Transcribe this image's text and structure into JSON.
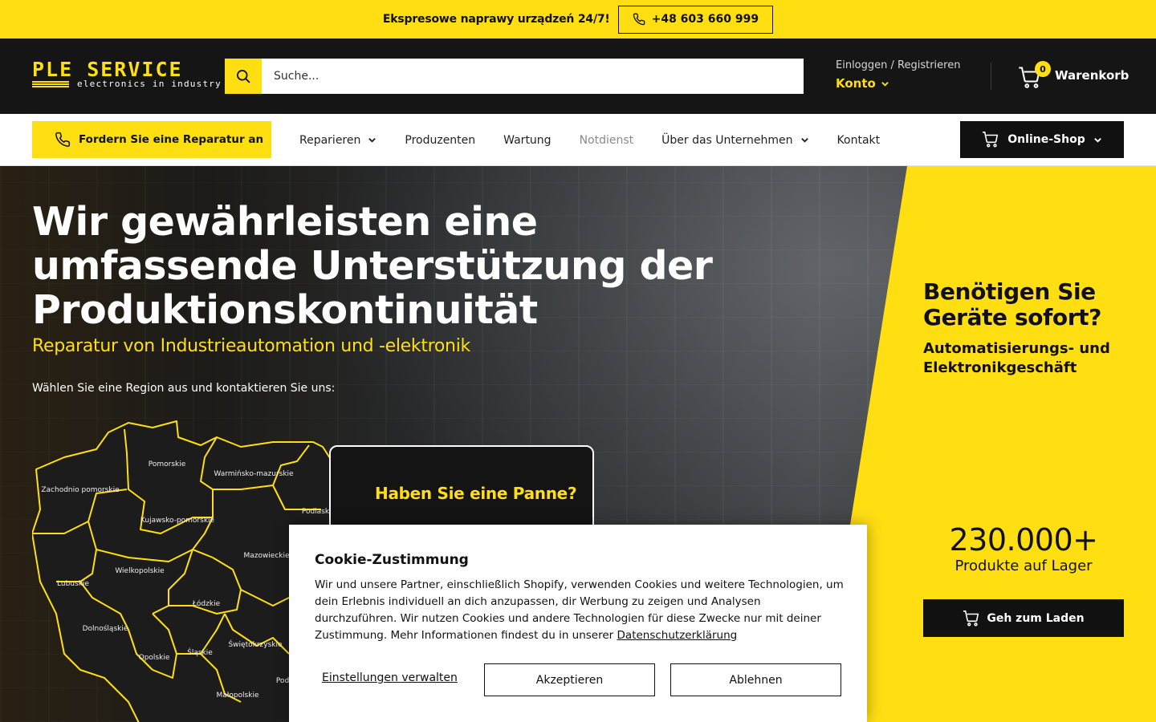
{
  "topbar": {
    "announcement": "Ekspresowe naprawy urządzeń 24/7!",
    "phone": "+48 603 660 999"
  },
  "header": {
    "logo_text": "PLE SERVICE",
    "logo_tagline": "electronics in industry",
    "search_placeholder": "Suche...",
    "login_label": "Einloggen / Registrieren",
    "account_label": "Konto",
    "cart_count": "0",
    "cart_label": "Warenkorb"
  },
  "nav": {
    "repair_button": "Fordern Sie eine Reparatur an",
    "links": [
      {
        "label": "Reparieren",
        "has_dropdown": true
      },
      {
        "label": "Produzenten",
        "has_dropdown": false
      },
      {
        "label": "Wartung",
        "has_dropdown": false
      },
      {
        "label": "Notdienst",
        "has_dropdown": false
      },
      {
        "label": "Über das Unternehmen",
        "has_dropdown": true
      },
      {
        "label": "Kontakt",
        "has_dropdown": false
      }
    ],
    "shop_button": "Online-Shop"
  },
  "hero": {
    "title": "Wir gewährleisten eine umfassende Unterstützung der Produktionskontinuität",
    "subtitle": "Reparatur von Industrieautomation und -elektronik",
    "region_prompt": "Wählen Sie eine Region aus und kontaktieren Sie uns:",
    "breakdown_title": "Haben Sie eine Panne?",
    "regions": [
      "Pomorskie",
      "Warmińsko-mazurskie",
      "Zachodnio pomorskie",
      "Kujawsko-pomorskie",
      "Podlaskie",
      "Mazowieckie",
      "Wielkopolskie",
      "Lubuskie",
      "Łódzkie",
      "Dolnośląskie",
      "Świętokrzyskie",
      "Opolskie",
      "Śląskie",
      "Małopolskie",
      "Pod"
    ]
  },
  "promo": {
    "title": "Benötigen Sie Geräte sofort?",
    "subtitle": "Automatisierungs- und Elektronikgeschäft",
    "count": "230.000+",
    "count_label": "Produkte auf Lager",
    "cta": "Geh zum Laden"
  },
  "cookie": {
    "title": "Cookie-Zustimmung",
    "body": "Wir und unsere Partner, einschließlich Shopify, verwenden Cookies und weitere Technologien, um dein Erlebnis individuell an dich anzupassen, dir Werbung zu zeigen und Analysen durchzuführen. Wir nutzen Cookies und andere Technologien für diese Zwecke nur mit deiner Zustimmung. Mehr Informationen findest du in unserer",
    "privacy_link": "Datenschutzerklärung",
    "manage": "Einstellungen verwalten",
    "accept": "Akzeptieren",
    "decline": "Ablehnen"
  },
  "colors": {
    "accent": "#ffdf12",
    "dark": "#151515"
  }
}
